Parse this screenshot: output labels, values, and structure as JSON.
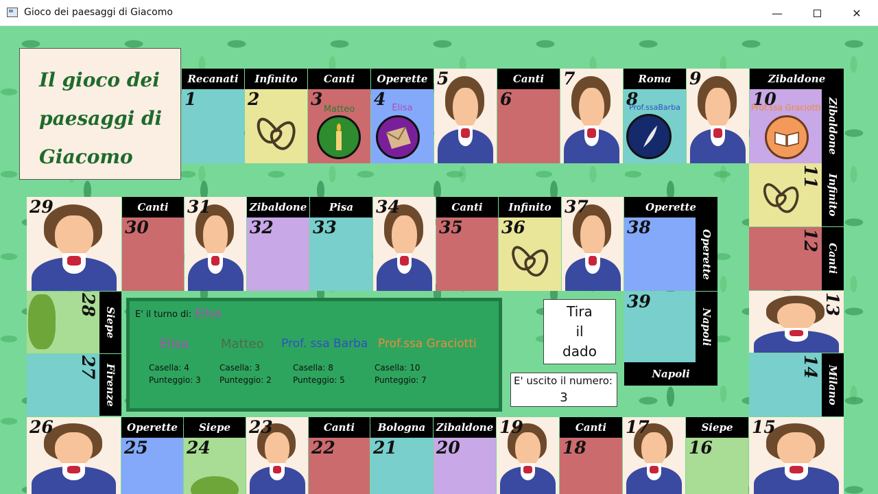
{
  "window": {
    "title": "Gioco dei paesaggi di Giacomo"
  },
  "board_title": [
    "Il gioco dei",
    "paesaggi di",
    "Giacomo"
  ],
  "squares": {
    "s1": {
      "num": "1",
      "label": "Recanati"
    },
    "s2": {
      "num": "2",
      "label": "Infinito"
    },
    "s3": {
      "num": "3",
      "label": "Canti"
    },
    "s4": {
      "num": "4",
      "label": "Operette"
    },
    "s5": {
      "num": "5"
    },
    "s6": {
      "num": "6",
      "label": "Canti"
    },
    "s7": {
      "num": "7"
    },
    "s8": {
      "num": "8",
      "label": "Roma"
    },
    "s9": {
      "num": "9"
    },
    "s10": {
      "num": "10",
      "label": "Zibaldone"
    },
    "s11": {
      "num": "11",
      "label": "Infinito"
    },
    "s12": {
      "num": "12",
      "label": "Canti"
    },
    "s13": {
      "num": "13"
    },
    "s14": {
      "num": "14",
      "label": "Milano"
    },
    "s15": {
      "num": "15"
    },
    "s16": {
      "num": "16",
      "label": "Siepe"
    },
    "s17": {
      "num": "17"
    },
    "s18": {
      "num": "18",
      "label": "Canti"
    },
    "s19": {
      "num": "19"
    },
    "s20": {
      "num": "20",
      "label": "Zibaldone"
    },
    "s21": {
      "num": "21",
      "label": "Bologna"
    },
    "s22": {
      "num": "22",
      "label": "Canti"
    },
    "s23": {
      "num": "23"
    },
    "s24": {
      "num": "24",
      "label": "Siepe"
    },
    "s25": {
      "num": "25",
      "label": "Operette"
    },
    "s26": {
      "num": "26"
    },
    "s27": {
      "num": "27",
      "label": "Firenze"
    },
    "s28": {
      "num": "28",
      "label": "Siepe"
    },
    "s29": {
      "num": "29"
    },
    "s30": {
      "num": "30",
      "label": "Canti"
    },
    "s31": {
      "num": "31"
    },
    "s32": {
      "num": "32",
      "label": "Zibaldone"
    },
    "s33": {
      "num": "33",
      "label": "Pisa"
    },
    "s34": {
      "num": "34"
    },
    "s35": {
      "num": "35",
      "label": "Canti"
    },
    "s36": {
      "num": "36",
      "label": "Infinito"
    },
    "s37": {
      "num": "37"
    },
    "s38": {
      "num": "38",
      "label": "Operette"
    },
    "s39": {
      "num": "39",
      "label": "Napoli"
    },
    "s38b": {
      "label": "Operette"
    },
    "s39b": {
      "label": "Napoli"
    },
    "s10b": {
      "label": "Zibaldone"
    }
  },
  "tokens": {
    "matteo": {
      "name": "Matteo",
      "square": 3,
      "color": "#2f7a2f"
    },
    "elisa": {
      "name": "Elisa",
      "square": 4,
      "color": "#b04cb4"
    },
    "barba": {
      "name": "Prof.ssaBarba",
      "square": 8,
      "color": "#2f4fc4"
    },
    "graciotti": {
      "name": "Prof.ssa Graciotti",
      "square": 10,
      "color": "#f08a3a"
    }
  },
  "turn": {
    "prefix": "E' il turno di:",
    "player": "Elisa"
  },
  "players": [
    {
      "name": "Elisa",
      "color": "#b04cb4",
      "casella": "Casella: 4",
      "punteggio": "Punteggio: 3"
    },
    {
      "name": "Matteo",
      "color": "#4a6b4a",
      "casella": "Casella: 3",
      "punteggio": "Punteggio: 2"
    },
    {
      "name": "Prof. ssa Barba",
      "color": "#2f4fc4",
      "casella": "Casella: 8",
      "punteggio": "Punteggio: 5"
    },
    {
      "name": "Prof.ssa Graciotti",
      "color": "#f08a3a",
      "casella": "Casella: 10",
      "punteggio": "Punteggio: 7"
    }
  ],
  "dice": {
    "button_lines": [
      "Tira",
      "il",
      "dado"
    ],
    "result_label": "E' uscito il numero:",
    "result_value": "3"
  }
}
